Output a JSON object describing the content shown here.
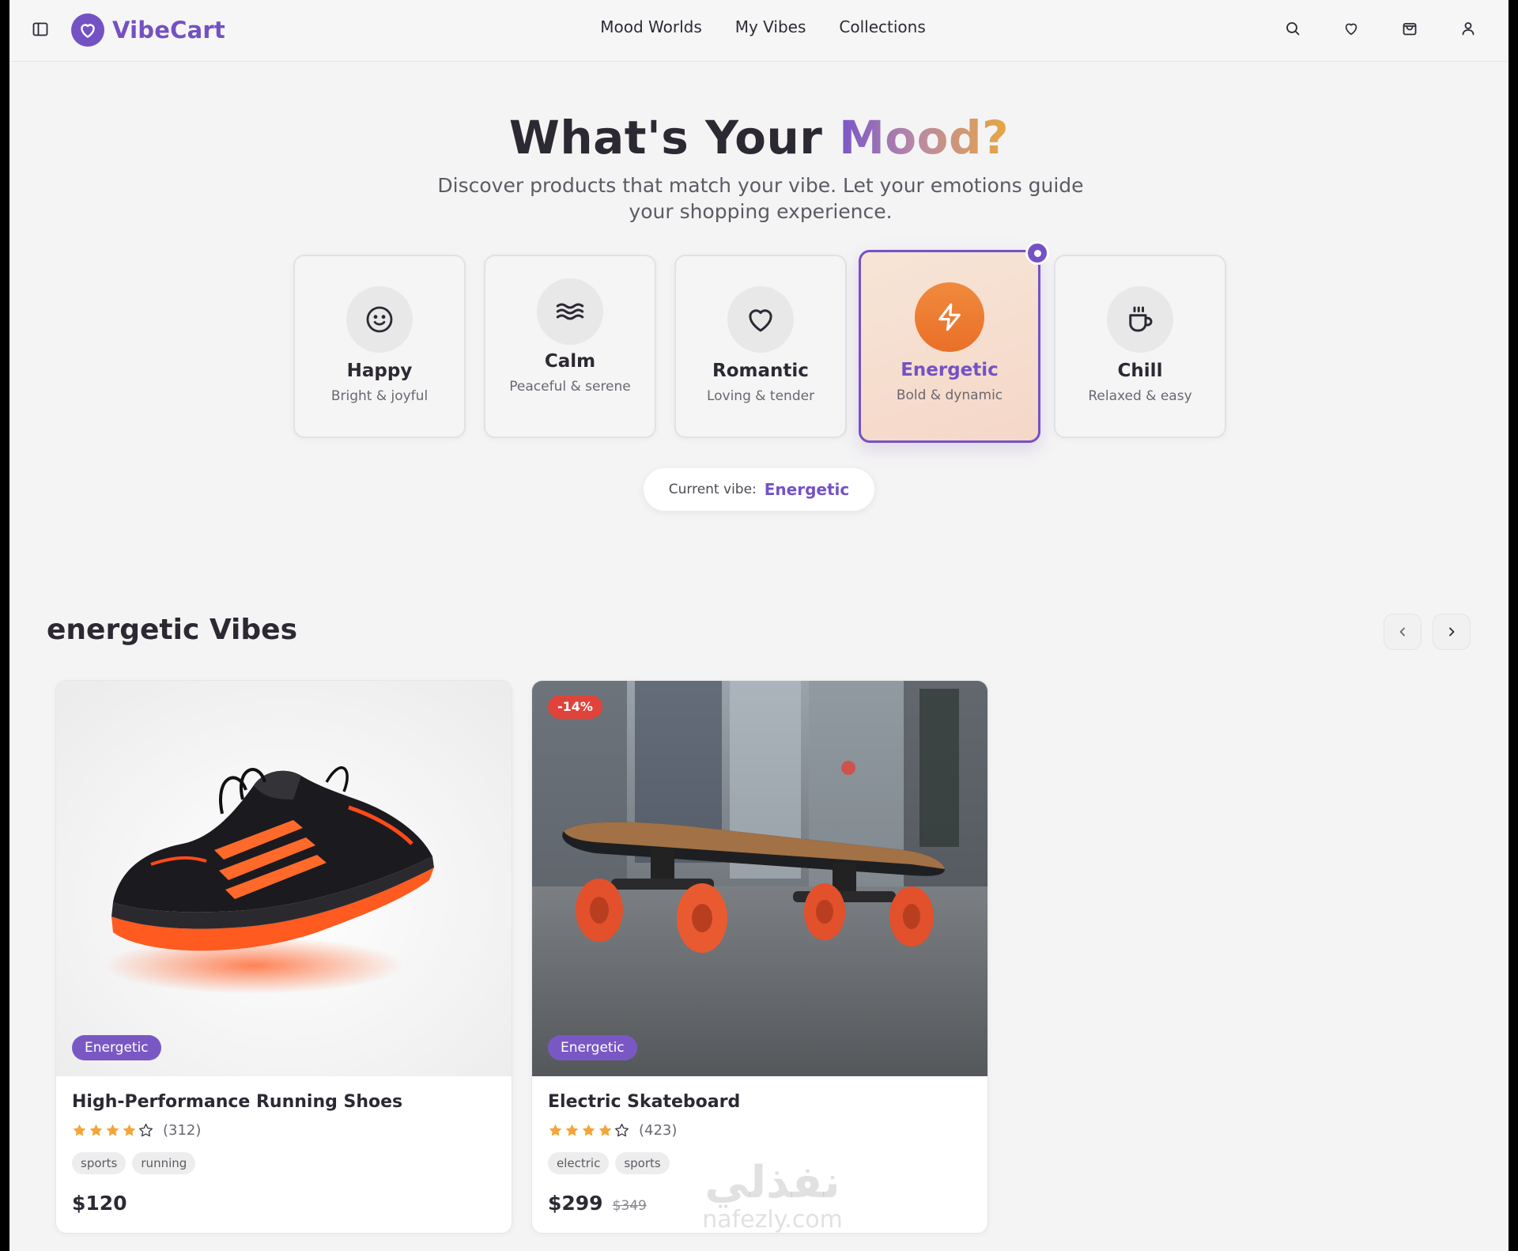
{
  "brand": {
    "name": "VibeCart",
    "accent": "#7452c4"
  },
  "nav": [
    "Mood Worlds",
    "My Vibes",
    "Collections"
  ],
  "header_icons": [
    "search-icon",
    "heart-icon",
    "shopping-bag-icon",
    "user-icon"
  ],
  "hero": {
    "title_plain": "What's Your ",
    "title_gradient": "Mood?",
    "subtitle": "Discover products that match your vibe. Let your emotions guide your shopping experience."
  },
  "moods": [
    {
      "label": "Happy",
      "desc": "Bright & joyful",
      "icon": "smile-icon",
      "active": false
    },
    {
      "label": "Calm",
      "desc": "Peaceful & serene",
      "icon": "waves-icon",
      "active": false
    },
    {
      "label": "Romantic",
      "desc": "Loving & tender",
      "icon": "heart-icon",
      "active": false
    },
    {
      "label": "Energetic",
      "desc": "Bold & dynamic",
      "icon": "lightning-icon",
      "active": true
    },
    {
      "label": "Chill",
      "desc": "Relaxed & easy",
      "icon": "coffee-cup-icon",
      "active": false
    }
  ],
  "current_vibe": {
    "label": "Current vibe:",
    "value": "Energetic"
  },
  "section": {
    "title": "energetic Vibes"
  },
  "products": [
    {
      "name": "High-Performance Running Shoes",
      "mood_tag": "Energetic",
      "rating": 4,
      "reviews": "(312)",
      "tags": [
        "sports",
        "running"
      ],
      "price": "$120",
      "old_price": "",
      "discount": ""
    },
    {
      "name": "Electric Skateboard",
      "mood_tag": "Energetic",
      "rating": 4,
      "reviews": "(423)",
      "tags": [
        "electric",
        "sports"
      ],
      "price": "$299",
      "old_price": "$349",
      "discount": "-14%"
    }
  ],
  "watermark": {
    "main": "نفذلي",
    "sub": "nafezly.com"
  }
}
